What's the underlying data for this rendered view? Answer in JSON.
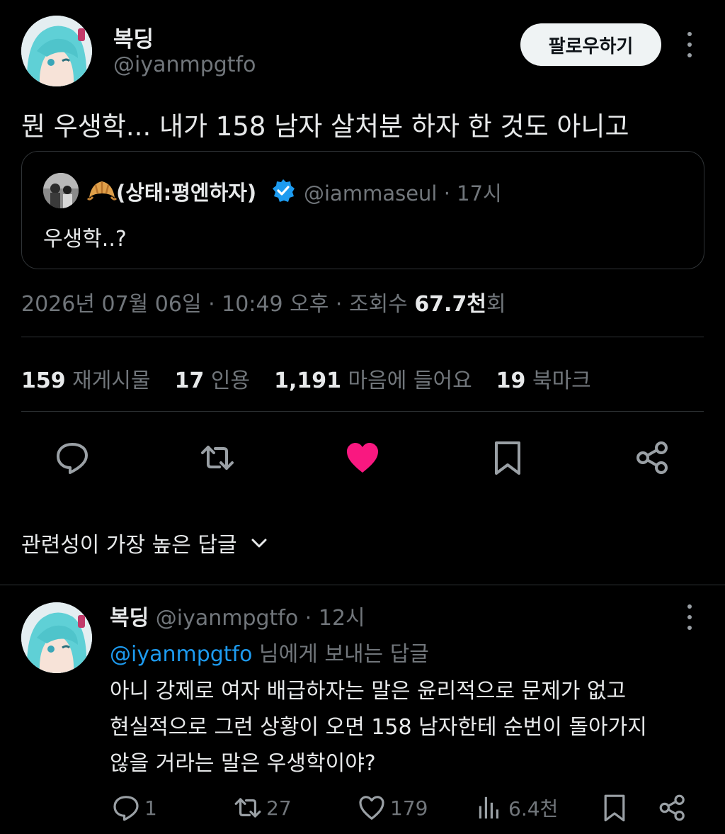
{
  "colors": {
    "background": "#000000",
    "like": "#f91880",
    "mention": "#1d9bf0",
    "muted": "#71767b",
    "text": "#e7e9ea"
  },
  "tweet": {
    "author_name": "복딩",
    "author_handle": "@iyanmpgtfo",
    "follow_label": "팔로우하기",
    "text": "뭔 우생학... 내가 158 남자 살처분 하자 한 것도 아니고",
    "quote": {
      "emoji_icon": "croissant-icon",
      "author_name": "(상태:평엔하자)",
      "author_handle": "@iammaseul",
      "time": "· 17시",
      "text": "우생학..?"
    },
    "meta": {
      "datetime": "2026년 07월 06일 · 10:49 오후 · 조회수 ",
      "views": "67.7천",
      "views_suffix": "회"
    },
    "stats": [
      {
        "count": "159",
        "label": "재게시물"
      },
      {
        "count": "17",
        "label": "인용"
      },
      {
        "count": "1,191",
        "label": "마음에 들어요"
      },
      {
        "count": "19",
        "label": "북마크"
      }
    ],
    "liked": true
  },
  "replies_sort": {
    "label": "관련성이 가장 높은 답글"
  },
  "reply": {
    "author_name": "복딩",
    "author_handle": "@iyanmpgtfo",
    "time": "· 12시",
    "replying_to_handle": "@iyanmpgtfo",
    "replying_to_suffix": " 님에게 보내는 답글",
    "lines": [
      "아니 강제로 여자 배급하자는 말은 윤리적으로 문제가 없고",
      "현실적으로 그런 상황이 오면 158 남자한테 순번이 돌아가지",
      "않을 거라는 말은 우생학이야?"
    ],
    "actions": {
      "replies": "1",
      "reposts": "27",
      "likes": "179",
      "views": "6.4천"
    }
  }
}
